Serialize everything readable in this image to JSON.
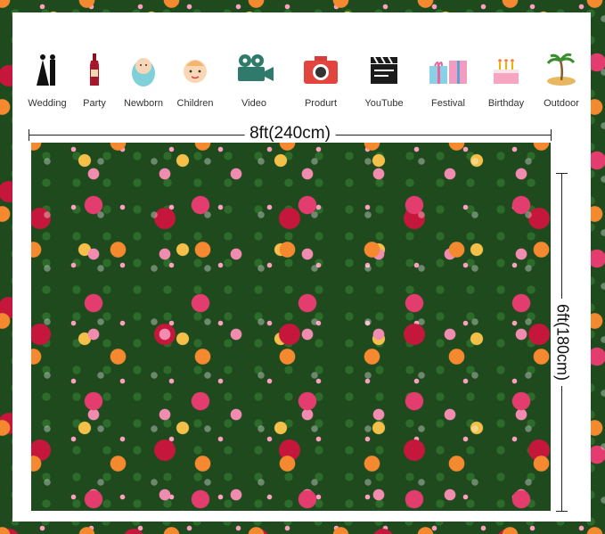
{
  "categories": [
    {
      "label": "Wedding",
      "icon": "wedding-couple-icon"
    },
    {
      "label": "Party",
      "icon": "wine-bottle-icon"
    },
    {
      "label": "Newborn",
      "icon": "newborn-baby-icon"
    },
    {
      "label": "Children",
      "icon": "child-face-icon"
    },
    {
      "label": "Video",
      "icon": "film-projector-icon"
    },
    {
      "label": "Produrt",
      "icon": "camera-icon"
    },
    {
      "label": "YouTube",
      "icon": "clapperboard-icon"
    },
    {
      "label": "Festival",
      "icon": "gift-boxes-icon"
    },
    {
      "label": "Birthday",
      "icon": "birthday-cake-icon"
    },
    {
      "label": "Outdoor",
      "icon": "palm-island-icon"
    }
  ],
  "dimensions": {
    "width_label": "8ft(240cm)",
    "height_label": "6ft(180cm)"
  }
}
